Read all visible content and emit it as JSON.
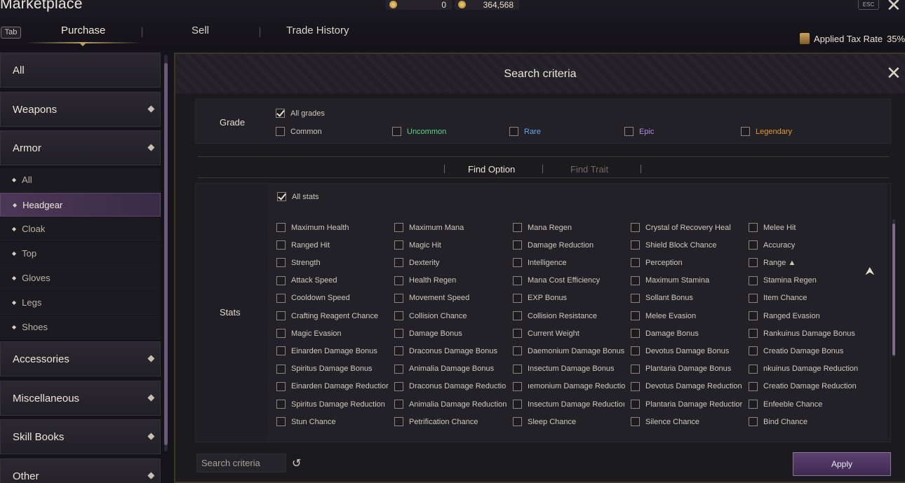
{
  "header": {
    "title": "Marketplace",
    "currency1": "0",
    "currency2": "364,568",
    "esc_key": "ESC",
    "close": "✕",
    "tab_key": "Tab",
    "tabs": [
      "Purchase",
      "Sell",
      "Trade History"
    ],
    "tax_label": "Applied Tax Rate",
    "tax_value": "35%"
  },
  "sidebar": {
    "categories": [
      {
        "label": "All",
        "chev": ""
      },
      {
        "label": "Weapons",
        "chev": "⯁"
      },
      {
        "label": "Armor",
        "chev": "⯁"
      },
      {
        "label": "Accessories",
        "chev": "⯁"
      },
      {
        "label": "Miscellaneous",
        "chev": "⯁"
      },
      {
        "label": "Skill Books",
        "chev": "⯁"
      },
      {
        "label": "Other",
        "chev": "⯁"
      }
    ],
    "armor_subs": [
      "All",
      "Headgear",
      "Cloak",
      "Top",
      "Gloves",
      "Legs",
      "Shoes"
    ]
  },
  "panel": {
    "title": "Search criteria",
    "close": "✕",
    "grade_label": "Grade",
    "all_grades": "All grades",
    "grades": [
      {
        "label": "Common",
        "color": "#d0cabe"
      },
      {
        "label": "Uncommon",
        "color": "#5ed68a"
      },
      {
        "label": "Rare",
        "color": "#6aa6ec"
      },
      {
        "label": "Epic",
        "color": "#b78ae8"
      },
      {
        "label": "Legendary",
        "color": "#e39a2e"
      }
    ],
    "find_option": "Find Option",
    "find_trait": "Find Trait",
    "stats_label": "Stats",
    "all_stats": "All stats",
    "stats": [
      [
        "Maximum Health",
        "Maximum Mana",
        "Mana Regen",
        "Crystal of Recovery Heal",
        "Melee Hit"
      ],
      [
        "Ranged Hit",
        "Magic Hit",
        "Damage Reduction",
        "Shield Block Chance",
        "Accuracy"
      ],
      [
        "Strength",
        "Dexterity",
        "Intelligence",
        "Perception",
        "Range ▲"
      ],
      [
        "Attack Speed",
        "Health Regen",
        "Mana Cost Efficiency",
        "Maximum Stamina",
        "Stamina Regen"
      ],
      [
        "Cooldown Speed",
        "Movement Speed",
        "EXP Bonus",
        "Sollant Bonus",
        "Item Chance"
      ],
      [
        "Crafting Reagent Chance",
        "Collision Chance",
        "Collision Resistance",
        "Melee Evasion",
        "Ranged Evasion"
      ],
      [
        "Magic Evasion",
        "Damage Bonus",
        "Current Weight",
        "Damage Bonus",
        "Rankuinus Damage Bonus"
      ],
      [
        "Einarden Damage Bonus",
        "Draconus Damage Bonus",
        "Daemonium Damage Bonus",
        "Devotus Damage Bonus",
        "Creatio Damage Bonus"
      ],
      [
        "Spiritus Damage Bonus",
        "Animalia Damage Bonus",
        "Insectum Damage Bonus",
        "Plantaria Damage Bonus",
        "nkuinus Damage Reduction"
      ],
      [
        "Einarden Damage Reductior",
        "Draconus Damage Reductio",
        "ıemonium Damage Reductio",
        "Devotus Damage Reduction",
        "Creatio Damage Reduction"
      ],
      [
        "Spiritus Damage Reduction",
        "Animalia Damage Reduction",
        "Insectum Damage Reductioı",
        "Plantaria Damage Reductior",
        "Enfeeble Chance"
      ],
      [
        "Stun Chance",
        "Petrification Chance",
        "Sleep Chance",
        "Silence Chance",
        "Bind Chance"
      ]
    ],
    "search_placeholder": "Search criteria",
    "reset_icon": "↺",
    "apply": "Apply"
  }
}
